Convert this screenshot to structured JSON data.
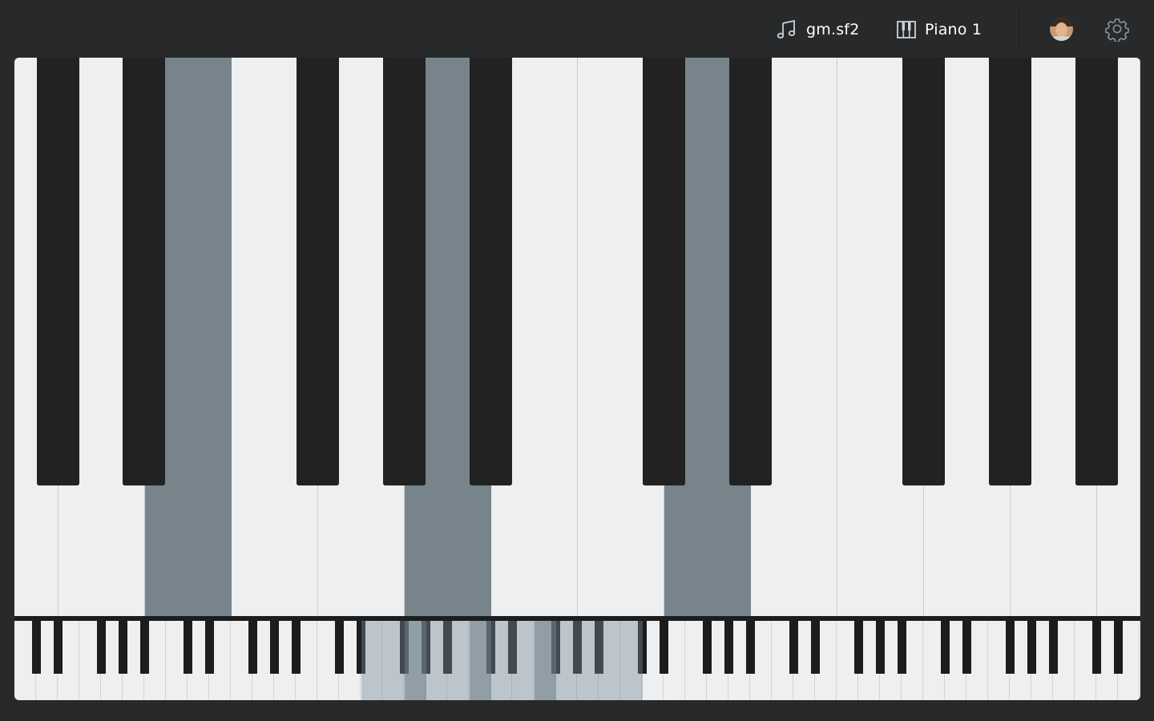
{
  "header": {
    "soundfont": {
      "label": "gm.sf2",
      "icon": "music-note-icon"
    },
    "instrument": {
      "label": "Piano 1",
      "icon": "piano-icon"
    },
    "avatar_icon": "user-avatar",
    "settings_icon": "gear-icon"
  },
  "keyboard": {
    "visible_white_keys": 13,
    "pressed_keys": [
      "E",
      "A",
      "D"
    ],
    "colors": {
      "white_key": "#eeeff1",
      "black_key": "#222222",
      "pressed": "#77848c",
      "background": "#27292b"
    }
  },
  "mini_keyboard": {
    "octaves": 7.5,
    "viewport_label": "visible-range"
  }
}
